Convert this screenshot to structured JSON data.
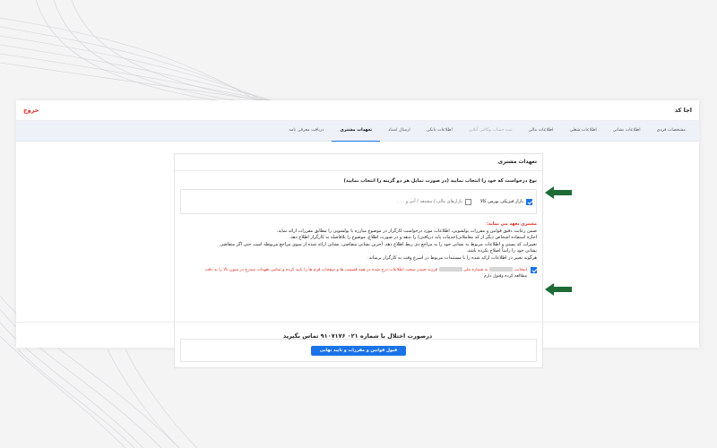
{
  "app": {
    "title": "اجا کد",
    "logout": "خروج"
  },
  "tabs": [
    {
      "label": "مشخصات فردی",
      "state": "normal"
    },
    {
      "label": "اطلاعات نشانی",
      "state": "normal"
    },
    {
      "label": "اطلاعات شغلی",
      "state": "normal"
    },
    {
      "label": "اطلاعات مالی",
      "state": "normal"
    },
    {
      "label": "ثبت حساب وکالتی آنلاین",
      "state": "disabled"
    },
    {
      "label": "اطلاعات بانکی",
      "state": "normal"
    },
    {
      "label": "ارسال اسناد",
      "state": "normal"
    },
    {
      "label": "تعهدات مشتری",
      "state": "active"
    },
    {
      "label": "دریافت معرفی نامه",
      "state": "normal"
    }
  ],
  "card": {
    "heading": "تعهدات مشتری",
    "request_type": "نوع درخواست که خود را انتخاب نمایید (در صورت تمایل هر دو گزینه را انتخاب نمایید)",
    "options": [
      {
        "label": "بازار فیزیکی بورس کالا",
        "checked": true
      },
      {
        "label": "بازارهای مالی / مشتقه / آتی و . . .",
        "checked": false
      }
    ],
    "commit_title": "مشتری تعهد می نماید:",
    "commit_lines": [
      "ضمن رعایت دقیق قوانین و مقررات پولشویی، اطلاعات مورد درخواست کارگزار در موضوع مبارزه با پولشویی را مطابق مقررات ارائه نماید.",
      "اجازه استفاده اشخاص دیگر از کد معاملاتی(خدمات پایه دریافتی) را ندهد و در صورت اطلاع، موضوع را بلافاصله به کارگزار اطلاع دهد.",
      "تغییرات کد پستی و اطلاعات مربوط به نشانی خود را به مراجع ذی ربط اطلاع دهد. آخرین نشانی متقاضی، نشانی ارائه شده از سوی مراجع مربوطه است حتی اگر متقاضی",
      "نشانی خود را راساً اصلاح نکرده باشد.",
      "هرگونه تغییر در اطلاعات ارائه شده را با مستندات مربوط در اسرع وقت به کارگزار برساند."
    ],
    "agree_prefix": "اینجانب",
    "agree_mid": "به شماره ملی",
    "agree_rest": "فرزند حییدر صحت اطلاعات درج شده در همه قسمت ها و صفحات فرم ها را تایید کرده و تمامی تعهدات مندرج در متون بالا را به دقت",
    "agree_line2": "مطالعه کرده وقبول دارم",
    "agree_checked": true,
    "submit_label": "قبول قوانین و مقررات و تایید نهایی"
  },
  "footer": {
    "text": "درصورت اختلال با شماره ۰۲۱ ۹۱۰۷۱۷۶ تماس بگیرید"
  },
  "colors": {
    "accent": "#1a73e8",
    "danger": "#e0281e",
    "arrow": "#1e6b36"
  }
}
